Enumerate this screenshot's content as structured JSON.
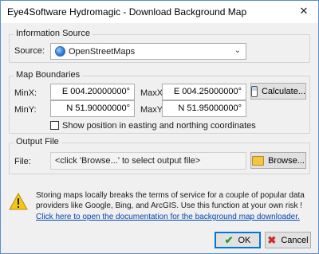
{
  "window": {
    "title": "Eye4Software Hydromagic - Download Background Map",
    "close_glyph": "✕"
  },
  "information_source": {
    "group_label": "Information Source",
    "source_label": "Source:",
    "source_value": "OpenStreetMaps",
    "source_icon": "globe-icon"
  },
  "map_boundaries": {
    "group_label": "Map Boundaries",
    "minx_label": "MinX:",
    "minx_value": "E 004.20000000°",
    "maxx_label": "MaxX:",
    "maxx_value": "E 004.25000000°",
    "miny_label": "MinY:",
    "miny_value": "N 51.90000000°",
    "maxy_label": "MaxY:",
    "maxy_value": "N 51.95000000°",
    "calculate_button": "Calculate...",
    "easting_checkbox_label": "Show position in easting and northing coordinates",
    "easting_checked": false
  },
  "output_file": {
    "group_label": "Output File",
    "file_label": "File:",
    "file_value": "<click 'Browse...' to select output file>",
    "browse_button": "Browse..."
  },
  "warning": {
    "line1": "Storing maps locally breaks the terms of service for a couple of popular data",
    "line2": "providers like Google, Bing, and ArcGIS. Use this function at your own risk !",
    "link": "Click here to open the documentation for the background map downloader."
  },
  "footer": {
    "ok_button": "OK",
    "cancel_button": "Cancel"
  },
  "colors": {
    "accent": "#0078d7",
    "link": "#0645ad",
    "warning_yellow": "#f5c518"
  }
}
